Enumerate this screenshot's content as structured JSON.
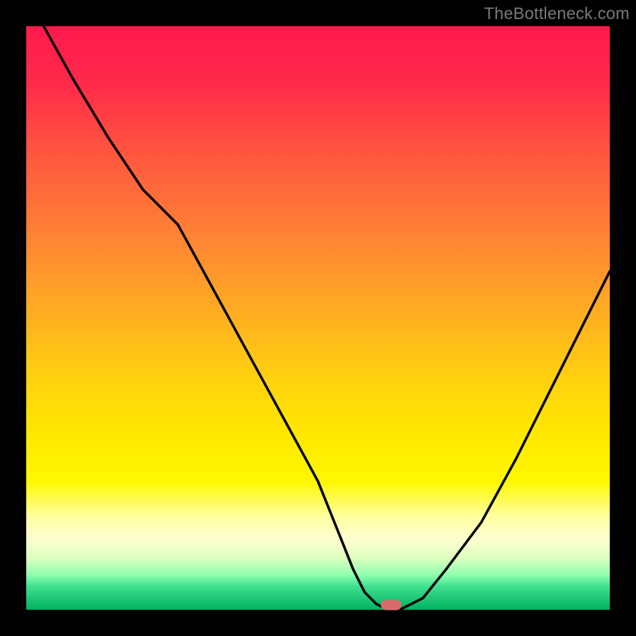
{
  "watermark": "TheBottleneck.com",
  "chart_data": {
    "type": "line",
    "title": "",
    "xlabel": "",
    "ylabel": "",
    "xlim": [
      0,
      100
    ],
    "ylim": [
      0,
      100
    ],
    "grid": false,
    "series": [
      {
        "name": "bottleneck-curve",
        "x": [
          3,
          8,
          14,
          20,
          26,
          32,
          38,
          44,
          50,
          54,
          56,
          58,
          60,
          62,
          64,
          68,
          72,
          78,
          84,
          90,
          96,
          100
        ],
        "y": [
          100,
          91,
          81,
          72,
          66,
          55,
          44,
          33,
          22,
          12,
          7,
          3,
          1,
          0,
          0,
          2,
          7,
          15,
          26,
          38,
          50,
          58
        ]
      }
    ],
    "marker": {
      "x": 62.5,
      "y": 0.8,
      "color": "#d96b6b"
    },
    "gradient_stops": [
      {
        "pos": 0,
        "color": "#ff1a4d"
      },
      {
        "pos": 50,
        "color": "#ffd010"
      },
      {
        "pos": 78,
        "color": "#fff800"
      },
      {
        "pos": 100,
        "color": "#00b060"
      }
    ]
  }
}
